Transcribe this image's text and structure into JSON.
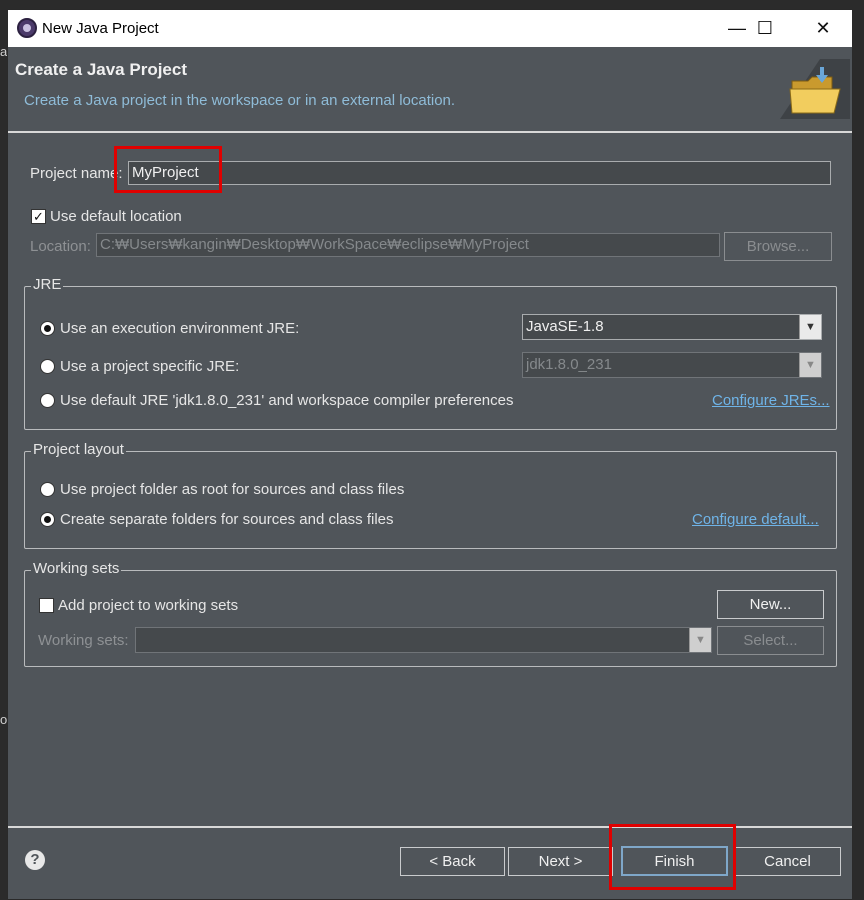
{
  "window": {
    "title": "New Java Project",
    "controls": {
      "minimize": "—",
      "maximize": "☐",
      "close": "✕"
    }
  },
  "header": {
    "title": "Create a Java Project",
    "description": "Create a Java project in the workspace or in an external location.",
    "icon": "folder-icon"
  },
  "project": {
    "name_label": "Project name:",
    "name_value": "MyProject",
    "use_default_label": "Use default location",
    "use_default_checked": true,
    "location_label": "Location:",
    "location_value": "C:₩Users₩kangin₩Desktop₩WorkSpace₩eclipse₩MyProject",
    "browse_label": "Browse..."
  },
  "jre": {
    "title": "JRE",
    "options": [
      {
        "label": "Use an execution environment JRE:",
        "selected": true
      },
      {
        "label": "Use a project specific JRE:",
        "selected": false
      },
      {
        "label": "Use default JRE 'jdk1.8.0_231' and workspace compiler preferences",
        "selected": false
      }
    ],
    "exec_env_value": "JavaSE-1.8",
    "project_jre_value": "jdk1.8.0_231",
    "configure_link": "Configure JREs..."
  },
  "layout": {
    "title": "Project layout",
    "options": [
      {
        "label": "Use project folder as root for sources and class files",
        "selected": false
      },
      {
        "label": "Create separate folders for sources and class files",
        "selected": true
      }
    ],
    "configure_link": "Configure default..."
  },
  "working_sets": {
    "title": "Working sets",
    "add_label": "Add project to working sets",
    "add_checked": false,
    "new_label": "New...",
    "sets_label": "Working sets:",
    "sets_value": "",
    "select_label": "Select..."
  },
  "footer": {
    "help": "?",
    "back_label": "< Back",
    "next_label": "Next >",
    "finish_label": "Finish",
    "cancel_label": "Cancel"
  },
  "colors": {
    "dialog_bg": "#50555a",
    "link": "#6fb4e8",
    "annotation": "#e00000"
  }
}
